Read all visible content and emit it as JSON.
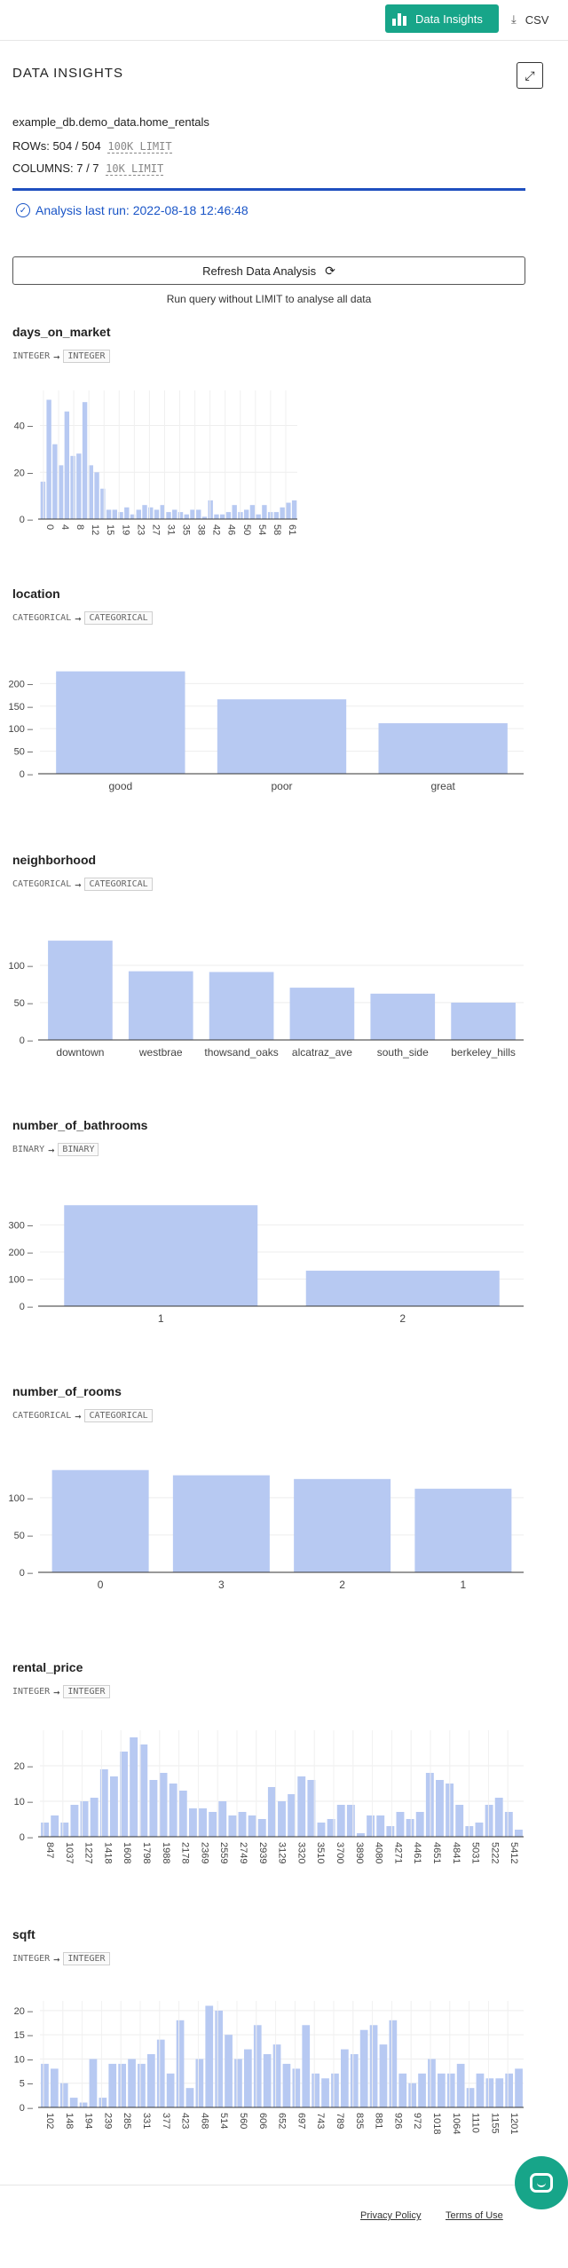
{
  "toolbar": {
    "insights_label": "Data Insights",
    "csv_label": "CSV"
  },
  "header": {
    "title": "DATA INSIGHTS"
  },
  "summary": {
    "table_name": "example_db.demo_data.home_rentals",
    "rows_text": "ROWs: 504 / 504",
    "rows_limit": "100K LIMIT",
    "columns_text": "COLUMNS: 7 / 7",
    "columns_limit": "10K LIMIT",
    "last_run": "Analysis last run: 2022-08-18 12:46:48"
  },
  "actions": {
    "refresh_label": "Refresh Data Analysis",
    "hint": "Run query without LIMIT to analyse all data"
  },
  "colors": {
    "bar": "#b7c9f2",
    "accent": "#17a589",
    "link": "#1a55c7"
  },
  "columns": [
    {
      "name": "days_on_market",
      "from_type": "INTEGER",
      "to_type": "INTEGER",
      "chart_data": {
        "type": "bar",
        "categories": [
          "0",
          "4",
          "8",
          "12",
          "15",
          "19",
          "23",
          "27",
          "31",
          "35",
          "38",
          "42",
          "46",
          "50",
          "54",
          "58",
          "61"
        ],
        "values": [
          16,
          51,
          32,
          23,
          46,
          27,
          28,
          50,
          23,
          20,
          13,
          4,
          4,
          3,
          5,
          2,
          4,
          6,
          5,
          4,
          6,
          3,
          4,
          3,
          2,
          4,
          4,
          1,
          8,
          2,
          2,
          3,
          6,
          3,
          4,
          6,
          2,
          6,
          3,
          3,
          5,
          7,
          8
        ],
        "ylim": [
          0,
          55
        ],
        "yticks": [
          0,
          20,
          40
        ]
      }
    },
    {
      "name": "location",
      "from_type": "CATEGORICAL",
      "to_type": "CATEGORICAL",
      "chart_data": {
        "type": "bar",
        "categories": [
          "good",
          "poor",
          "great"
        ],
        "values": [
          227,
          165,
          112
        ],
        "ylim": [
          0,
          240
        ],
        "yticks": [
          0,
          50,
          100,
          150,
          200
        ]
      }
    },
    {
      "name": "neighborhood",
      "from_type": "CATEGORICAL",
      "to_type": "CATEGORICAL",
      "chart_data": {
        "type": "bar",
        "categories": [
          "downtown",
          "westbrae",
          "thowsand_oaks",
          "alcatraz_ave",
          "south_side",
          "berkeley_hills"
        ],
        "values": [
          133,
          92,
          91,
          70,
          62,
          50
        ],
        "ylim": [
          0,
          145
        ],
        "yticks": [
          0,
          50,
          100
        ]
      }
    },
    {
      "name": "number_of_bathrooms",
      "from_type": "BINARY",
      "to_type": "BINARY",
      "chart_data": {
        "type": "bar",
        "categories": [
          "1",
          "2"
        ],
        "values": [
          373,
          131
        ],
        "ylim": [
          0,
          400
        ],
        "yticks": [
          0,
          100,
          200,
          300
        ]
      }
    },
    {
      "name": "number_of_rooms",
      "from_type": "CATEGORICAL",
      "to_type": "CATEGORICAL",
      "chart_data": {
        "type": "bar",
        "categories": [
          "0",
          "3",
          "2",
          "1"
        ],
        "values": [
          137,
          130,
          125,
          112
        ],
        "ylim": [
          0,
          145
        ],
        "yticks": [
          0,
          50,
          100
        ]
      }
    },
    {
      "name": "rental_price",
      "from_type": "INTEGER",
      "to_type": "INTEGER",
      "chart_data": {
        "type": "bar",
        "categories": [
          "847",
          "1037",
          "1227",
          "1418",
          "1608",
          "1798",
          "1988",
          "2178",
          "2369",
          "2559",
          "2749",
          "2939",
          "3129",
          "3320",
          "3510",
          "3700",
          "3890",
          "4080",
          "4271",
          "4461",
          "4651",
          "4841",
          "5031",
          "5222",
          "5412"
        ],
        "values": [
          4,
          6,
          4,
          9,
          10,
          11,
          19,
          17,
          24,
          28,
          26,
          16,
          18,
          15,
          13,
          8,
          8,
          7,
          10,
          6,
          7,
          6,
          5,
          14,
          10,
          12,
          17,
          16,
          4,
          5,
          9,
          9,
          1,
          6,
          6,
          3,
          7,
          5,
          7,
          18,
          16,
          15,
          9,
          3,
          4,
          9,
          11,
          7,
          2
        ],
        "ylim": [
          0,
          30
        ],
        "yticks": [
          0,
          10,
          20
        ]
      }
    },
    {
      "name": "sqft",
      "from_type": "INTEGER",
      "to_type": "INTEGER",
      "chart_data": {
        "type": "bar",
        "categories": [
          "102",
          "148",
          "194",
          "239",
          "285",
          "331",
          "377",
          "423",
          "468",
          "514",
          "560",
          "606",
          "652",
          "697",
          "743",
          "789",
          "835",
          "881",
          "926",
          "972",
          "1018",
          "1064",
          "1110",
          "1155",
          "1201"
        ],
        "values": [
          9,
          8,
          5,
          2,
          1,
          10,
          2,
          9,
          9,
          10,
          9,
          11,
          14,
          7,
          18,
          4,
          10,
          21,
          20,
          15,
          10,
          12,
          17,
          11,
          13,
          9,
          8,
          17,
          7,
          6,
          7,
          12,
          11,
          16,
          17,
          13,
          18,
          7,
          5,
          7,
          10,
          7,
          7,
          9,
          4,
          7,
          6,
          6,
          7,
          8
        ],
        "ylim": [
          0,
          22
        ],
        "yticks": [
          0,
          5,
          10,
          15,
          20
        ]
      }
    }
  ],
  "footer": {
    "privacy": "Privacy Policy",
    "terms": "Terms of Use"
  }
}
